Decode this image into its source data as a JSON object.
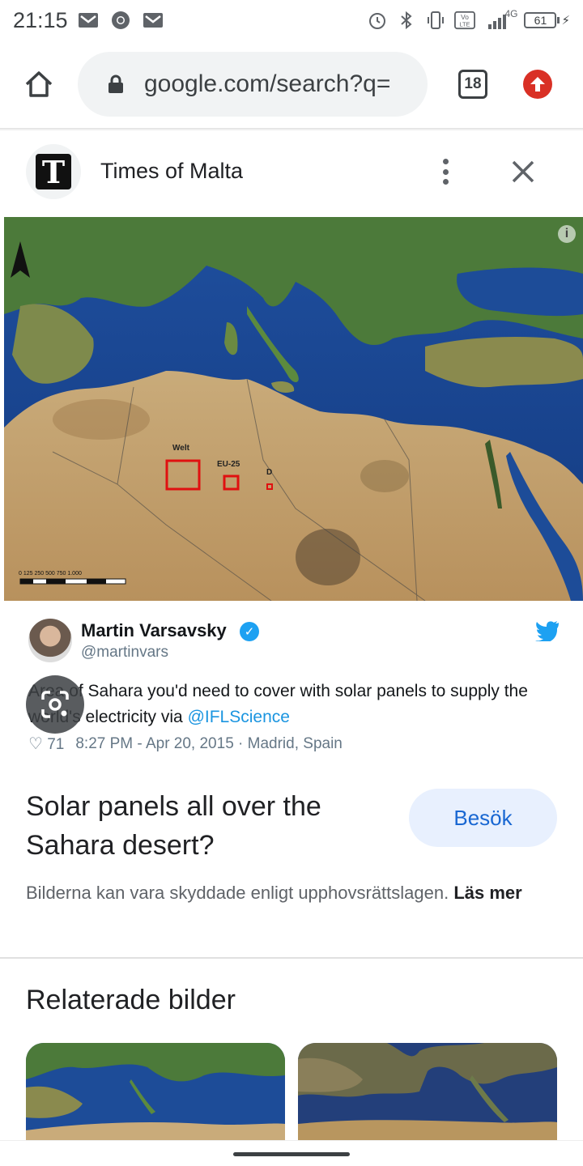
{
  "status_bar": {
    "time": "21:15",
    "left_icons": [
      "gmail-icon",
      "chrome-icon",
      "gmail-icon"
    ],
    "right_icons": [
      "alarm-icon",
      "bluetooth-icon",
      "vibrate-icon",
      "volte-icon",
      "signal-icon"
    ],
    "network": "4G",
    "battery": "61"
  },
  "browser": {
    "url": "google.com/search?q=",
    "tab_count": "18"
  },
  "source": {
    "logo_letter": "T",
    "name": "Times of Malta"
  },
  "image": {
    "map_labels": {
      "welt": "Welt",
      "eu": "EU-25",
      "d": "D",
      "scale": "0  125 250    500    750   1.000"
    },
    "tweet": {
      "name": "Martin Varsavsky",
      "handle": "@martinvars",
      "text": "Area of Sahara you'd need to cover with solar panels to supply the world's electricity via ",
      "link": "@IFLScience",
      "likes": "71",
      "datetime": "8:27 PM - Apr 20, 2015 · Madrid, Spain"
    }
  },
  "result": {
    "title": "Solar panels all over the Sahara desert?",
    "visit_label": "Besök",
    "copyright_text": "Bilderna kan vara skyddade enligt upphovsrättslagen. ",
    "read_more": "Läs mer"
  },
  "related": {
    "title": "Relaterade bilder"
  }
}
